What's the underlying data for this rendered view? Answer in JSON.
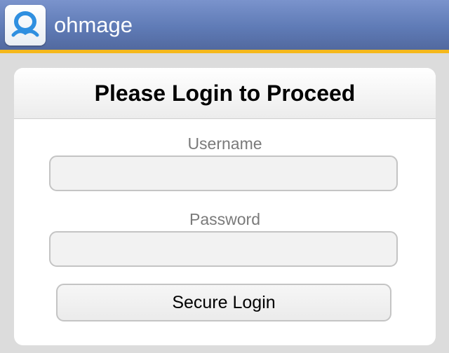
{
  "header": {
    "app_name": "ohmage",
    "logo_icon": "ohmage-logo-icon"
  },
  "login": {
    "title": "Please Login to Proceed",
    "username_label": "Username",
    "username_value": "",
    "password_label": "Password",
    "password_value": "",
    "submit_label": "Secure Login"
  },
  "colors": {
    "header_blue": "#5f7bb6",
    "header_accent": "#f5b81c",
    "background": "#dcdcdc",
    "logo_blue": "#2f8fe0"
  }
}
